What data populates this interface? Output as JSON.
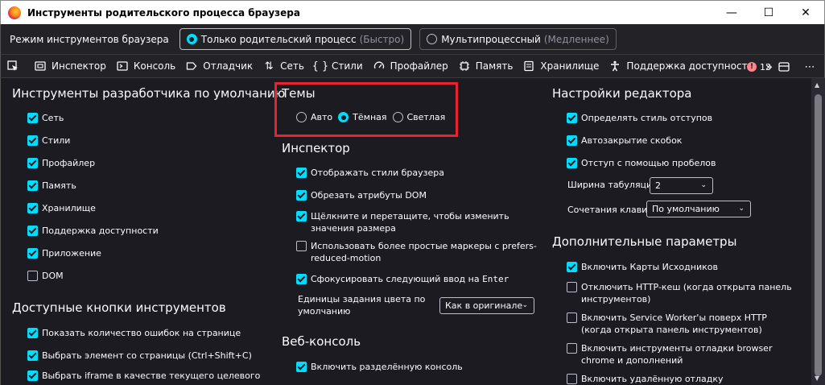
{
  "window": {
    "title": "Инструменты родительского процесса браузера",
    "controls": [
      "—",
      "☐",
      "✕"
    ]
  },
  "mode": {
    "label": "Режим инструментов браузера",
    "options": [
      {
        "label": "Только родительский процесс",
        "hint": "(Быстро)",
        "selected": true
      },
      {
        "label": "Мультипроцессный",
        "hint": "(Медленнее)",
        "selected": false
      }
    ]
  },
  "toolbar": {
    "tabs": [
      "Инспектор",
      "Консоль",
      "Отладчик",
      "Сеть",
      "Стили",
      "Профайлер",
      "Память",
      "Хранилище",
      "Поддержка доступности"
    ],
    "more": "»",
    "error_count": "13"
  },
  "defaults": {
    "title": "Инструменты разработчика по умолчанию",
    "items": [
      {
        "label": "Сеть",
        "checked": true
      },
      {
        "label": "Стили",
        "checked": true
      },
      {
        "label": "Профайлер",
        "checked": true
      },
      {
        "label": "Память",
        "checked": true
      },
      {
        "label": "Хранилище",
        "checked": true
      },
      {
        "label": "Поддержка доступности",
        "checked": true
      },
      {
        "label": "Приложение",
        "checked": true
      },
      {
        "label": "DOM",
        "checked": false
      }
    ]
  },
  "buttons": {
    "title": "Доступные кнопки инструментов",
    "items": [
      {
        "label": "Показать количество ошибок на странице",
        "checked": true
      },
      {
        "label": "Выбрать элемент со страницы (Ctrl+Shift+C)",
        "checked": true
      },
      {
        "label": "Выбрать iframe в качестве текущего целевого",
        "checked": true
      }
    ]
  },
  "themes": {
    "title": "Темы",
    "options": [
      {
        "label": "Авто",
        "selected": false
      },
      {
        "label": "Тёмная",
        "selected": true
      },
      {
        "label": "Светлая",
        "selected": false
      }
    ]
  },
  "inspector": {
    "title": "Инспектор",
    "items": [
      {
        "label": "Отображать стили браузера",
        "checked": true
      },
      {
        "label": "Обрезать атрибуты DOM",
        "checked": true
      },
      {
        "label": "Щёлкните и перетащите, чтобы изменить значения размера",
        "checked": true
      },
      {
        "label": "Использовать более простые маркеры с prefers-reduced-motion",
        "checked": false
      },
      {
        "label_pre": "Сфокусировать следующий ввод на ",
        "label_code": "Enter",
        "checked": true
      }
    ],
    "color_units_label": "Единицы задания цвета по умолчанию",
    "color_units_value": "Как в оригинале"
  },
  "webconsole": {
    "title": "Веб-консоль",
    "items": [
      {
        "label": "Включить разделённую консоль",
        "checked": true
      }
    ]
  },
  "editor": {
    "title": "Настройки редактора",
    "items": [
      {
        "label": "Определять стиль отступов",
        "checked": true
      },
      {
        "label": "Автозакрытие скобок",
        "checked": true
      },
      {
        "label": "Отступ с помощью пробелов",
        "checked": true
      }
    ],
    "tab_width_label": "Ширина табуляции",
    "tab_width_value": "2",
    "keybind_label": "Сочетания клавиш",
    "keybind_value": "По умолчанию"
  },
  "advanced": {
    "title": "Дополнительные параметры",
    "items": [
      {
        "label": "Включить Карты Исходников",
        "checked": true
      },
      {
        "label": "Отключить HTTP-кеш (когда открыта панель инструментов)",
        "checked": false
      },
      {
        "label": "Включить Service Worker'ы поверх HTTP (когда открыта панель инструментов)",
        "checked": false
      },
      {
        "label": "Включить инструменты отладки browser chrome и дополнений",
        "checked": false
      },
      {
        "label": "Включить удалённую отладку",
        "checked": false
      }
    ]
  },
  "colors": {
    "accent": "#00ddff",
    "background": "#1c1b22",
    "highlight": "#e8222e"
  }
}
